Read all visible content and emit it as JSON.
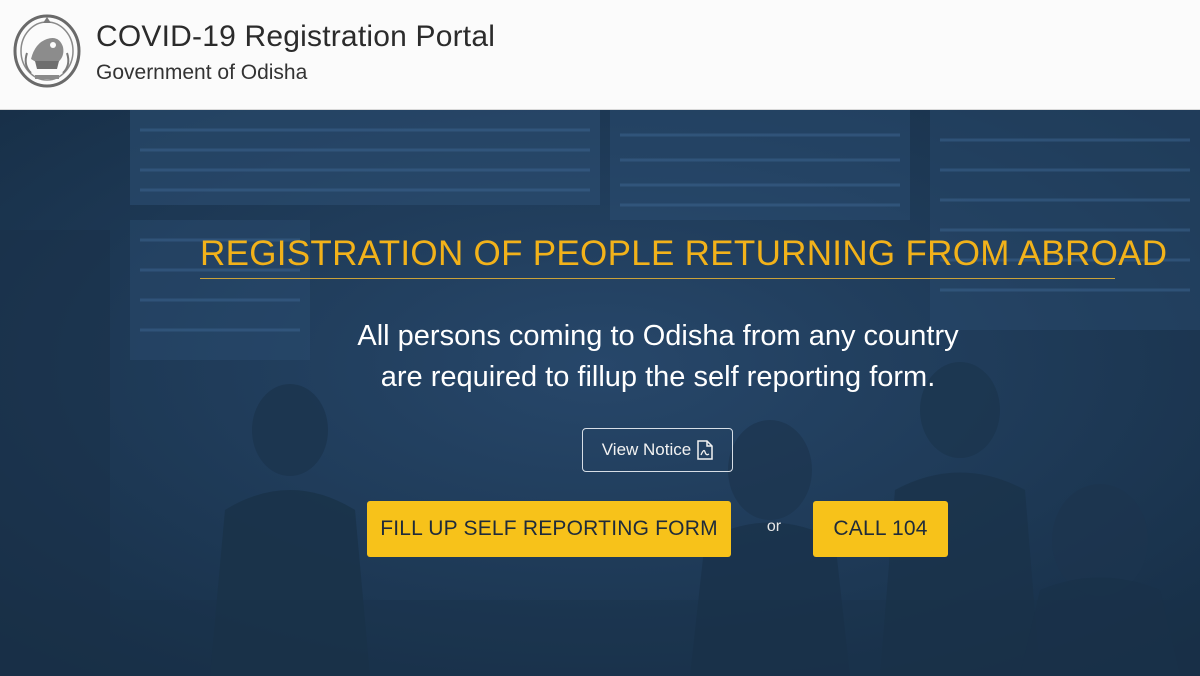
{
  "header": {
    "title": "COVID-19 Registration Portal",
    "subtitle": "Government of Odisha",
    "emblem_icon": "odisha-emblem-icon"
  },
  "hero": {
    "heading": "REGISTRATION OF PEOPLE RETURNING FROM ABROAD",
    "description_line1": "All persons coming to Odisha from any country",
    "description_line2": "are required to fillup the self reporting form.",
    "notice_button": "View Notice",
    "notice_icon": "pdf-icon",
    "form_button": "FILL UP SELF REPORTING FORM",
    "or_text": "or",
    "call_button": "CALL 104"
  },
  "colors": {
    "accent": "#f7c21a",
    "heading": "#f2b21a",
    "hero_bg": "#1f3a55",
    "header_bg": "#fbfbfb"
  }
}
